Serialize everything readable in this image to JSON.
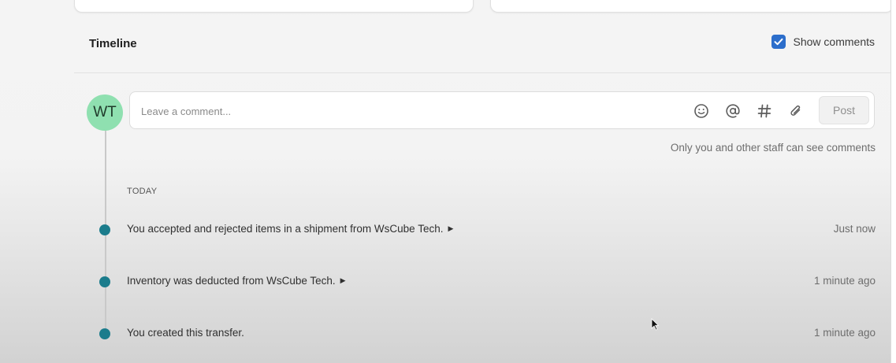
{
  "timeline": {
    "title": "Timeline",
    "show_comments_label": "Show comments",
    "show_comments_checked": true,
    "accent_color": "#2c6ecb"
  },
  "composer": {
    "avatar_initials": "WT",
    "avatar_color": "#8fe0b0",
    "placeholder": "Leave a comment...",
    "toolbar_icons": [
      "emoji-icon",
      "mention-icon",
      "hashtag-icon",
      "attachment-icon"
    ],
    "post_label": "Post",
    "privacy_note": "Only you and other staff can see comments"
  },
  "events": {
    "day_label": "TODAY",
    "dot_color": "#1b7c8c",
    "items": [
      {
        "text": "You accepted and rejected items in a shipment from WsCube Tech.",
        "expandable": true,
        "time": "Just now"
      },
      {
        "text": "Inventory was deducted from WsCube Tech.",
        "expandable": true,
        "time": "1 minute ago"
      },
      {
        "text": "You created this transfer.",
        "expandable": false,
        "time": "1 minute ago"
      }
    ]
  }
}
